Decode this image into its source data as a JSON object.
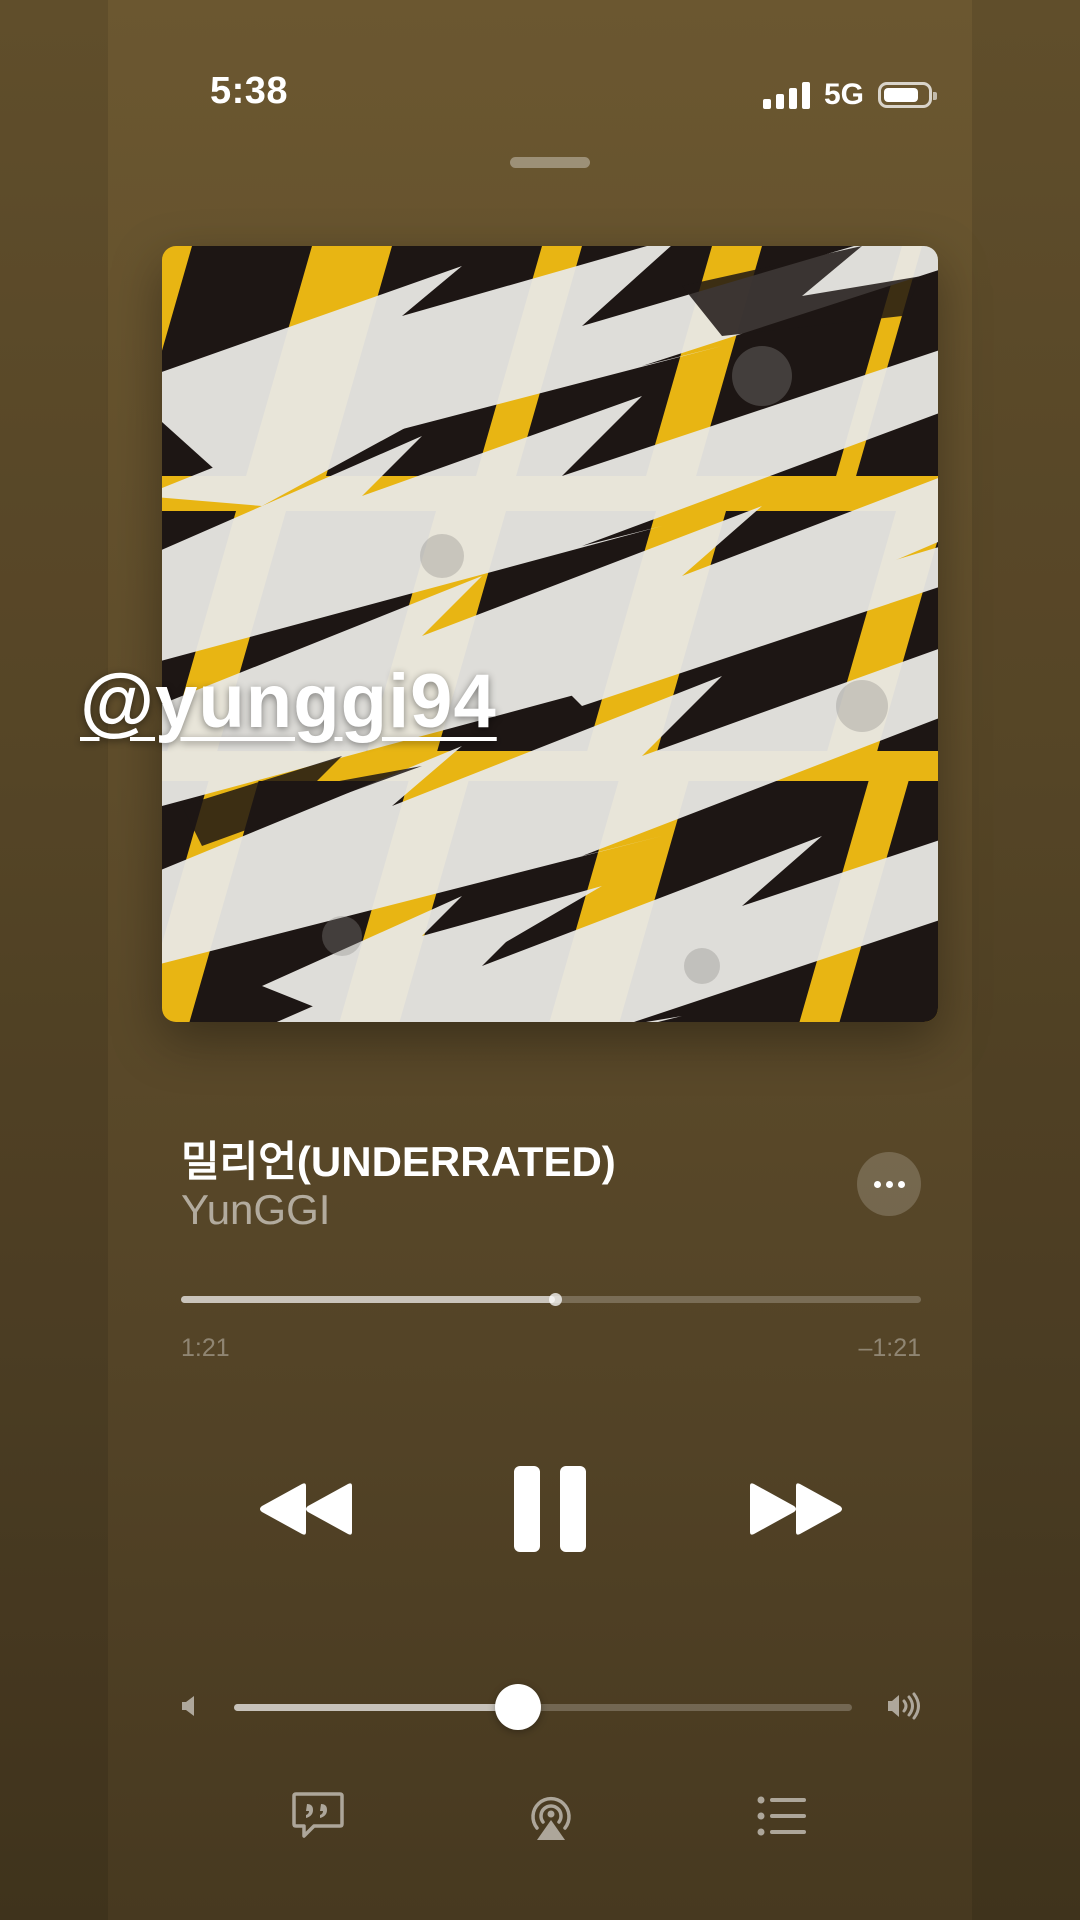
{
  "status_bar": {
    "time": "5:38",
    "network": "5G",
    "icons": [
      "signal-bars-icon",
      "battery-icon"
    ]
  },
  "watermark": {
    "text": "@yunggi94"
  },
  "now_playing": {
    "title": "밀리언(UNDERRATED)",
    "artist": "YunGGI",
    "progress_fraction": 0.505,
    "elapsed": "1:21",
    "remaining": "–1:21",
    "volume_fraction": 0.46
  },
  "controls": {
    "icons": [
      "rewind-icon",
      "pause-icon",
      "fast-forward-icon"
    ]
  },
  "bottom_bar": {
    "icons": [
      "lyrics-icon",
      "airplay-icon",
      "queue-list-icon"
    ]
  },
  "colors": {
    "background": "#5f4d2b",
    "artwork_yellow": "#e8b513",
    "artwork_dark": "#1d1614",
    "artwork_white": "#e9e8e4"
  }
}
